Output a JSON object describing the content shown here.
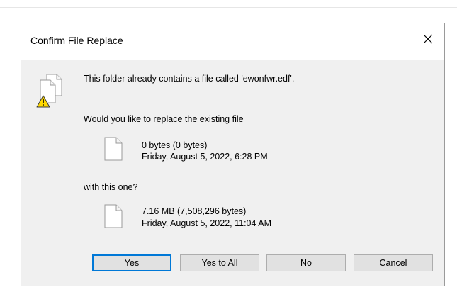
{
  "dialog": {
    "title": "Confirm File Replace",
    "message": "This folder already contains a file called 'ewonfwr.edf'.",
    "question": "Would you like to replace the existing file",
    "existing_file": {
      "size": "0 bytes (0 bytes)",
      "date": "Friday, August 5, 2022, 6:28 PM"
    },
    "with_label": "with this one?",
    "new_file": {
      "size": "7.16 MB (7,508,296 bytes)",
      "date": "Friday, August 5, 2022, 11:04 AM"
    },
    "buttons": {
      "yes": "Yes",
      "yes_to_all": "Yes to All",
      "no": "No",
      "cancel": "Cancel"
    }
  },
  "icons": {
    "close": "close-icon",
    "warning": "warning-files-icon",
    "file": "file-icon"
  },
  "colors": {
    "dialog_bg": "#f0f0f0",
    "title_bg": "#ffffff",
    "default_button_border": "#0078d7",
    "warning_yellow": "#ffd800"
  }
}
